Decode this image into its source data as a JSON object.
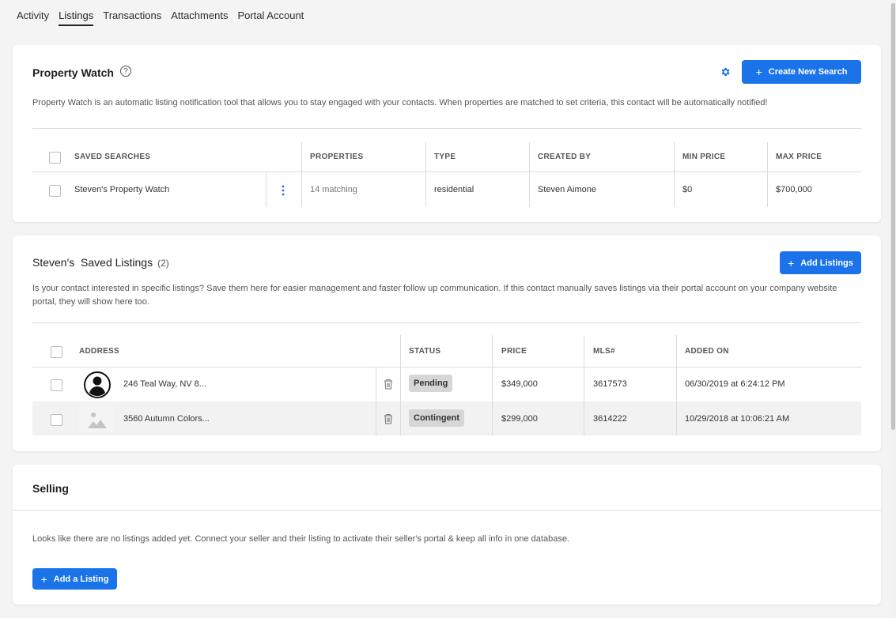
{
  "tabs": [
    {
      "label": "Activity"
    },
    {
      "label": "Listings"
    },
    {
      "label": "Transactions"
    },
    {
      "label": "Attachments"
    },
    {
      "label": "Portal Account"
    }
  ],
  "active_tab": "Listings",
  "property_watch": {
    "title": "Property Watch",
    "help_icon": "?",
    "create_button": "Create New Search",
    "description": "Property Watch is an automatic listing notification tool that allows you to stay engaged with your contacts. When properties are matched to set criteria, this contact will be automatically notified!",
    "columns": [
      "SAVED SEARCHES",
      "PROPERTIES",
      "TYPE",
      "CREATED BY",
      "MIN PRICE",
      "MAX PRICE"
    ],
    "rows": [
      {
        "name": "Steven's Property Watch",
        "properties": "14 matching",
        "type": "residential",
        "created_by": "Steven Aimone",
        "min_price": "$0",
        "max_price": "$700,000"
      }
    ]
  },
  "saved_listings": {
    "title": "Steven's  Saved Listings",
    "count": "(2)",
    "add_button": "Add Listings",
    "description": "Is your contact interested in specific listings? Save them here for easier management and faster follow up communication. If this contact manually saves listings via their portal account on your company website portal, they will show here too.",
    "columns": [
      "ADDRESS",
      "STATUS",
      "PRICE",
      "MLS#",
      "ADDED ON"
    ],
    "rows": [
      {
        "address": "246 Teal Way, NV 8...",
        "status": "Pending",
        "price": "$349,000",
        "mls": "3617573",
        "added_on": "06/30/2019 at 6:24:12 PM"
      },
      {
        "address": "3560 Autumn Colors...",
        "status": "Contingent",
        "price": "$299,000",
        "mls": "3614222",
        "added_on": "10/29/2018 at 10:06:21 AM"
      }
    ]
  },
  "selling": {
    "title": "Selling",
    "description": "Looks like there are no listings added yet. Connect your seller and their listing to activate their seller's portal & keep all info in one database.",
    "add_button": "Add a Listing"
  },
  "colors": {
    "accent": "#1a73e8",
    "badge_bg": "#d6d6d6",
    "row_highlight": "#f2f2f2"
  }
}
